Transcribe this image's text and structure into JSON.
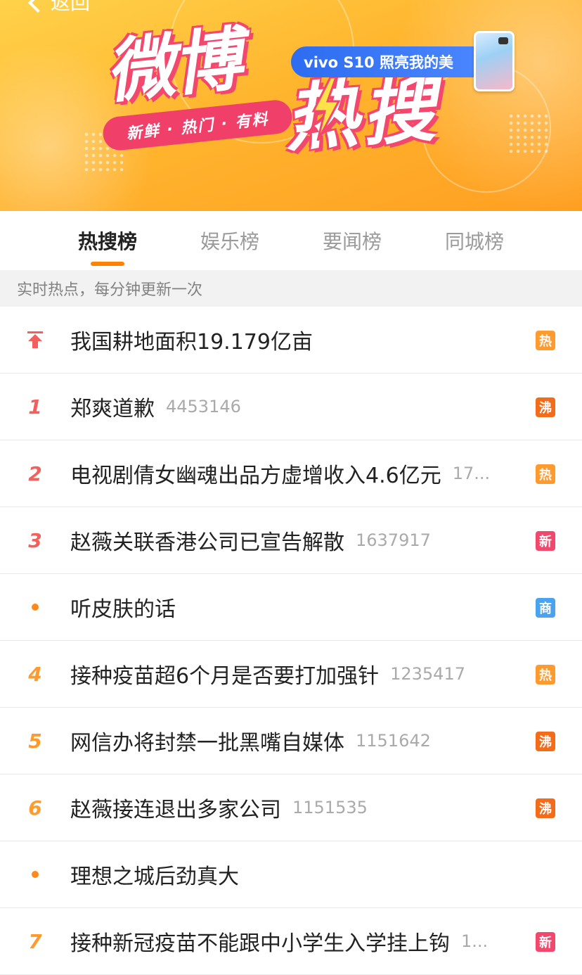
{
  "header": {
    "back_label": "返回",
    "brand_weibo": "微博",
    "brand_hot": "热搜",
    "slogan": "新鲜 · 热门 · 有料",
    "sponsor": "vivo S10 照亮我的美"
  },
  "tabs": [
    {
      "label": "热搜榜",
      "active": true
    },
    {
      "label": "娱乐榜",
      "active": false
    },
    {
      "label": "要闻榜",
      "active": false
    },
    {
      "label": "同城榜",
      "active": false
    }
  ],
  "subheader": "实时热点，每分钟更新一次",
  "items": [
    {
      "rank": "",
      "marker": "pin-icon",
      "title": "我国耕地面积19.179亿亩",
      "count": "",
      "badge": "热"
    },
    {
      "rank": "1",
      "marker": "rank",
      "title": "郑爽道歉",
      "count": "4453146",
      "badge": "沸"
    },
    {
      "rank": "2",
      "marker": "rank",
      "title": "电视剧倩女幽魂出品方虚增收入4.6亿元",
      "count": "17...",
      "badge": "热"
    },
    {
      "rank": "3",
      "marker": "rank",
      "title": "赵薇关联香港公司已宣告解散",
      "count": "1637917",
      "badge": "新"
    },
    {
      "rank": "",
      "marker": "dot-icon",
      "title": "听皮肤的话",
      "count": "",
      "badge": "商"
    },
    {
      "rank": "4",
      "marker": "rank",
      "title": "接种疫苗超6个月是否要打加强针",
      "count": "1235417",
      "badge": "热"
    },
    {
      "rank": "5",
      "marker": "rank",
      "title": "网信办将封禁一批黑嘴自媒体",
      "count": "1151642",
      "badge": "沸"
    },
    {
      "rank": "6",
      "marker": "rank",
      "title": "赵薇接连退出多家公司",
      "count": "1151535",
      "badge": "沸"
    },
    {
      "rank": "",
      "marker": "dot-icon",
      "title": "理想之城后劲真大",
      "count": "",
      "badge": ""
    },
    {
      "rank": "7",
      "marker": "rank",
      "title": "接种新冠疫苗不能跟中小学生入学挂上钩",
      "count": "1...",
      "badge": "新"
    }
  ],
  "colors": {
    "accent": "#ff8200",
    "rank_top": "#f25f5c",
    "rank_normal": "#ff9b2e",
    "badge_hot": "#ff9b2e",
    "badge_boil": "#f36c1a",
    "badge_new": "#f2486e",
    "badge_biz": "#4aa3ef"
  }
}
